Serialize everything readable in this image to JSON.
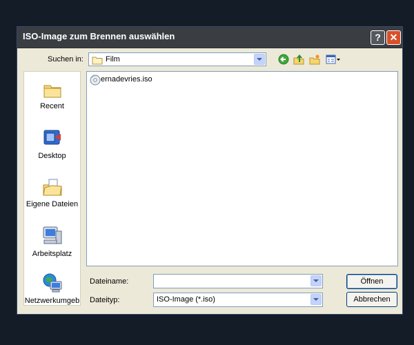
{
  "dialog": {
    "title": "ISO-Image zum Brennen auswählen"
  },
  "toolbar": {
    "lookin_label": "Suchen in:",
    "lookin_value": "Film",
    "icons": [
      "back-arrow-icon",
      "up-folder-icon",
      "new-folder-icon",
      "view-menu-icon"
    ]
  },
  "places": [
    {
      "label": "Recent",
      "icon": "recent-icon"
    },
    {
      "label": "Desktop",
      "icon": "desktop-icon"
    },
    {
      "label": "Eigene Dateien",
      "icon": "my-documents-icon"
    },
    {
      "label": "Arbeitsplatz",
      "icon": "my-computer-icon"
    },
    {
      "label": "Netzwerkumgeb",
      "icon": "network-icon"
    }
  ],
  "files": [
    {
      "name": "ernadevries.iso",
      "icon": "disc-image-icon"
    }
  ],
  "fields": {
    "filename_label": "Dateiname:",
    "filename_value": "",
    "filetype_label": "Dateityp:",
    "filetype_value": "ISO-Image (*.iso)"
  },
  "buttons": {
    "open": "Öffnen",
    "cancel": "Abbrechen"
  },
  "colors": {
    "background": "#141c28",
    "dialog": "#ece9d8",
    "titlebar": "#3a3d42",
    "close_button": "#d8502a"
  }
}
